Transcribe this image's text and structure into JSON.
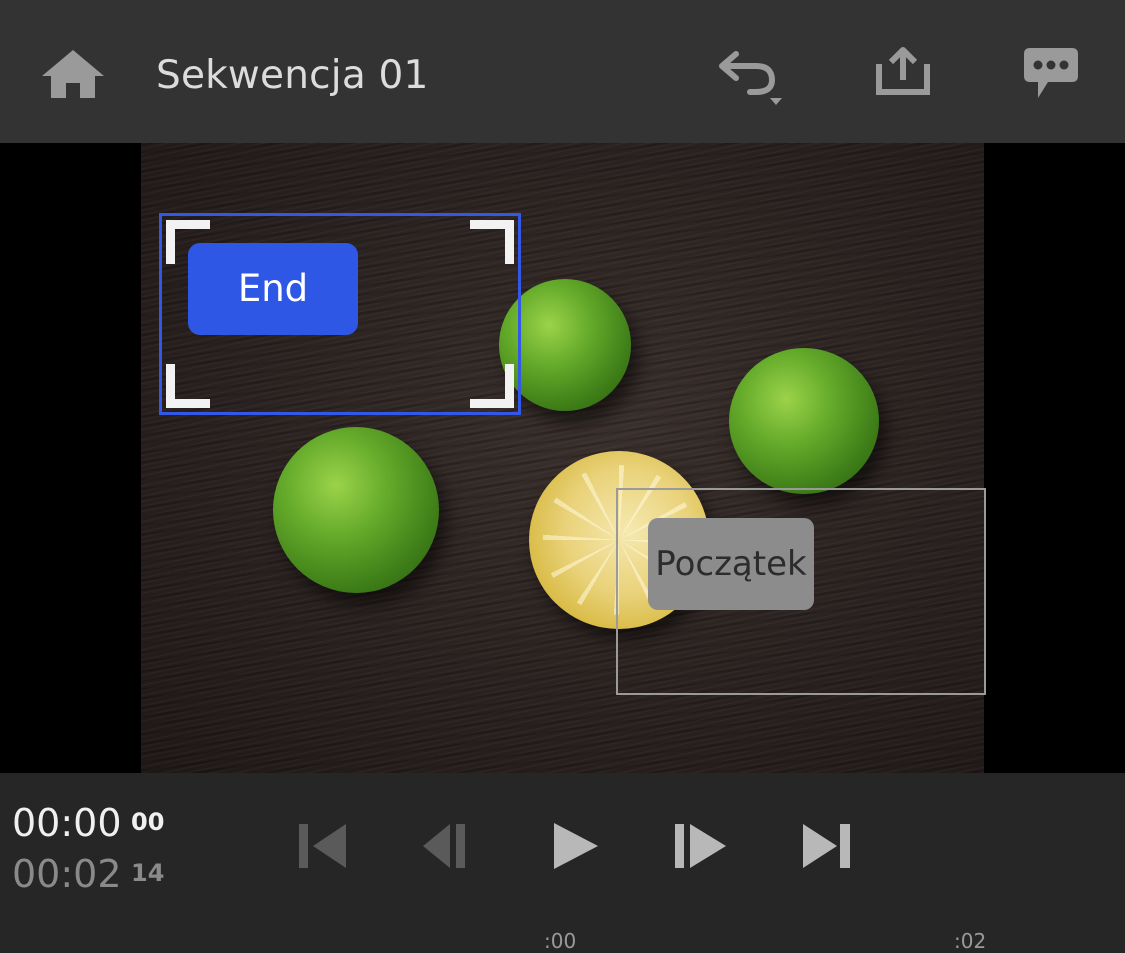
{
  "header": {
    "title": "Sekwencja 01",
    "icons": [
      "home-icon",
      "undo-icon",
      "share-icon",
      "comment-icon"
    ]
  },
  "viewer": {
    "titles": [
      {
        "label": "End",
        "selected": true
      },
      {
        "label": "Początek",
        "selected": false
      }
    ]
  },
  "timecode": {
    "current": "00:00",
    "current_frames": "00",
    "total": "00:02",
    "total_frames": "14"
  },
  "transport": {
    "icons": [
      "go-to-start-icon",
      "step-back-icon",
      "play-icon",
      "step-forward-icon",
      "go-to-end-icon"
    ]
  },
  "ruler": {
    "ticks": [
      ":00",
      ":02"
    ]
  },
  "colors": {
    "accent": "#2f57e6",
    "topbar": "#333333",
    "background": "#262626"
  }
}
